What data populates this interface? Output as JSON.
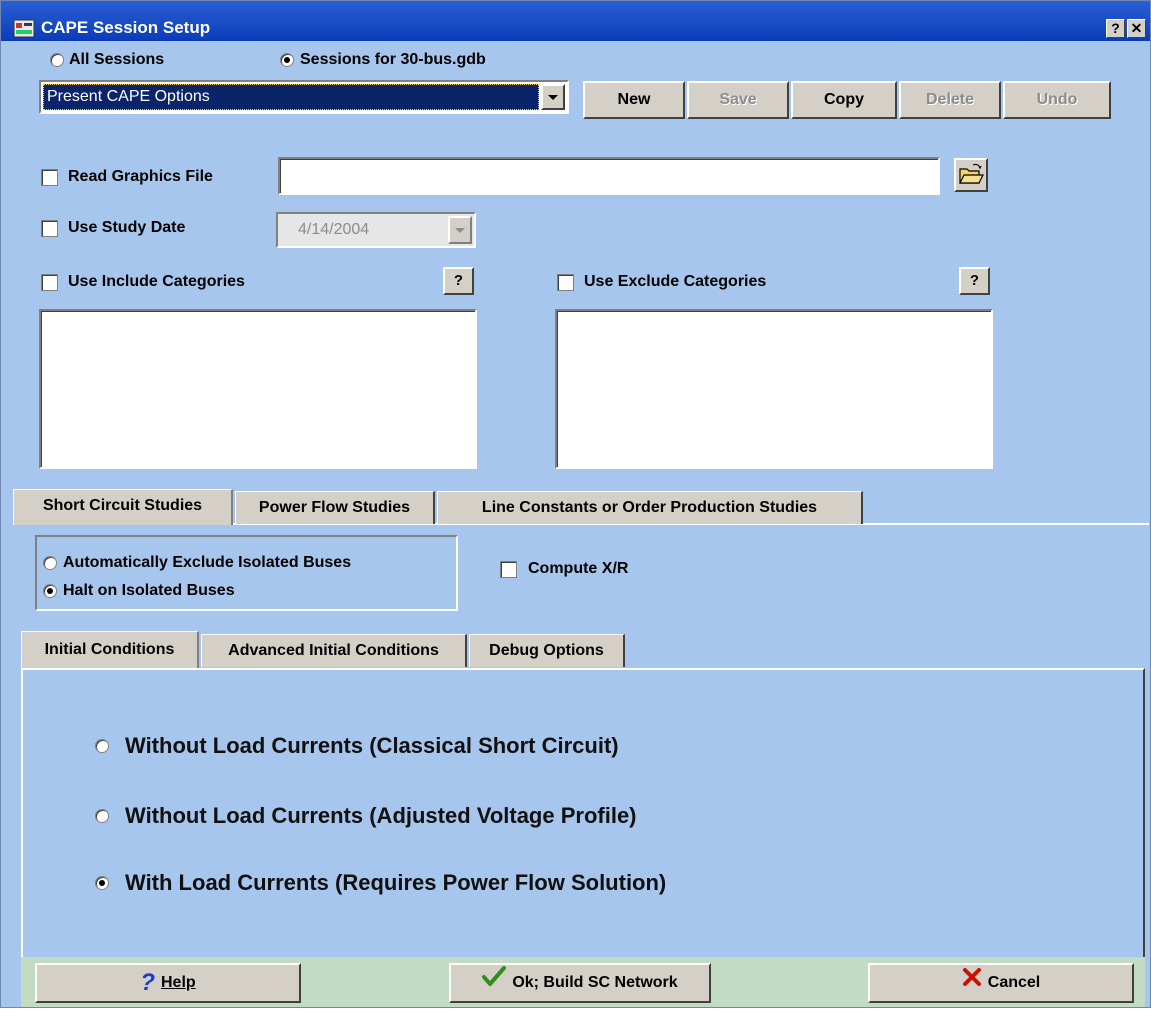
{
  "window": {
    "title": "CAPE Session Setup",
    "help_btn": "?",
    "close_btn": "✕"
  },
  "session_scope": {
    "all_sessions": "All Sessions",
    "sessions_for_db": "Sessions for 30-bus.gdb",
    "selected": "sessions_for_db"
  },
  "session_select": {
    "value": "Present CAPE Options"
  },
  "session_buttons": {
    "new": "New",
    "save": "Save",
    "copy": "Copy",
    "delete": "Delete",
    "undo": "Undo"
  },
  "read_graphics": {
    "label": "Read Graphics File",
    "checked": false,
    "path": ""
  },
  "study_date": {
    "label": "Use Study Date",
    "checked": false,
    "value": "4/14/2004"
  },
  "include_categories": {
    "label": "Use Include Categories",
    "help": "?",
    "checked": false
  },
  "exclude_categories": {
    "label": "Use Exclude Categories",
    "help": "?",
    "checked": false
  },
  "study_tabs": {
    "items": [
      "Short Circuit Studies",
      "Power Flow Studies",
      "Line Constants or Order Production Studies"
    ],
    "active": 0
  },
  "isolated_buses": {
    "auto_exclude": "Automatically Exclude Isolated Buses",
    "halt": "Halt on Isolated Buses",
    "selected": "halt"
  },
  "compute_xr": {
    "label": "Compute X/R",
    "checked": false
  },
  "sc_tabs": {
    "items": [
      "Initial Conditions",
      "Advanced Initial Conditions",
      "Debug Options"
    ],
    "active": 0
  },
  "initial_conditions": {
    "options": [
      "Without Load Currents (Classical Short Circuit)",
      "Without Load Currents (Adjusted Voltage Profile)",
      "With Load Currents (Requires Power Flow Solution)"
    ],
    "selected": 2
  },
  "footer": {
    "help": "Help",
    "ok": "Ok; Build SC Network",
    "cancel": "Cancel"
  },
  "colors": {
    "dialog_bg": "#a7c6ed",
    "titlebar": "#0a3cb8",
    "footer_bg": "#c2dcc4",
    "ok_check": "#2f8f1a",
    "cancel_x": "#cc1100",
    "help_q": "#1a3ec8"
  },
  "icons": {
    "app": "app-icon",
    "folder": "open-folder-icon",
    "dropdown": "chevron-down-icon",
    "help": "question-mark-icon",
    "ok": "checkmark-icon",
    "cancel": "x-mark-icon"
  }
}
